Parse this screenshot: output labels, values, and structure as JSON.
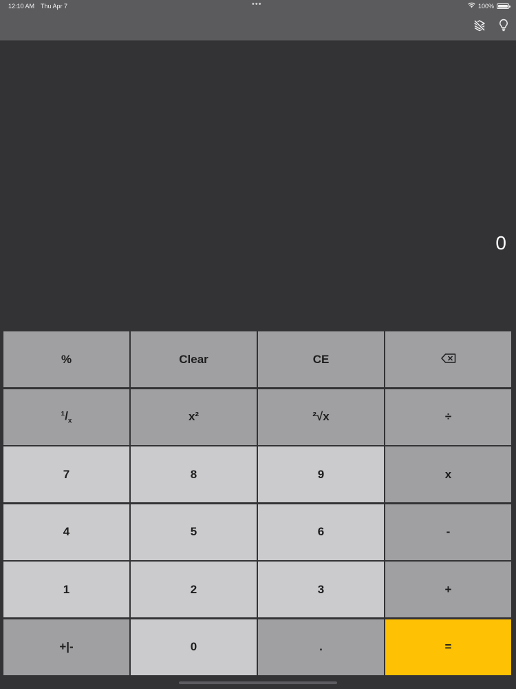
{
  "status_bar": {
    "time": "12:10 AM",
    "date": "Thu Apr 7",
    "dots": "•••",
    "battery_percent": "100%",
    "icons": [
      "wifi-icon",
      "battery-icon"
    ]
  },
  "toolbar": {
    "icons": [
      "layers-off-icon",
      "lightbulb-icon"
    ]
  },
  "display": {
    "value": "0"
  },
  "keypad": {
    "rows": [
      [
        "%",
        "Clear",
        "CE",
        "backspace"
      ],
      [
        "¹/ₓ",
        "x²",
        "²√x",
        "÷"
      ],
      [
        "7",
        "8",
        "9",
        "x"
      ],
      [
        "4",
        "5",
        "6",
        "-"
      ],
      [
        "1",
        "2",
        "3",
        "+"
      ],
      [
        "+|-",
        "0",
        ".",
        "="
      ]
    ],
    "labels": {
      "percent": "%",
      "clear": "Clear",
      "ce": "CE",
      "reciprocal_num": "¹",
      "reciprocal_den": "x",
      "square": "x²",
      "sqrt": "²√x",
      "divide": "÷",
      "seven": "7",
      "eight": "8",
      "nine": "9",
      "multiply": "x",
      "four": "4",
      "five": "5",
      "six": "6",
      "minus": "-",
      "one": "1",
      "two": "2",
      "three": "3",
      "plus": "+",
      "negate": "+|-",
      "zero": "0",
      "decimal": ".",
      "equals": "="
    }
  },
  "colors": {
    "background": "#333235",
    "bar": "#5b5a5d",
    "function_key": "#a09fa2",
    "number_key": "#cbcacd",
    "equals_key": "#fec104"
  }
}
